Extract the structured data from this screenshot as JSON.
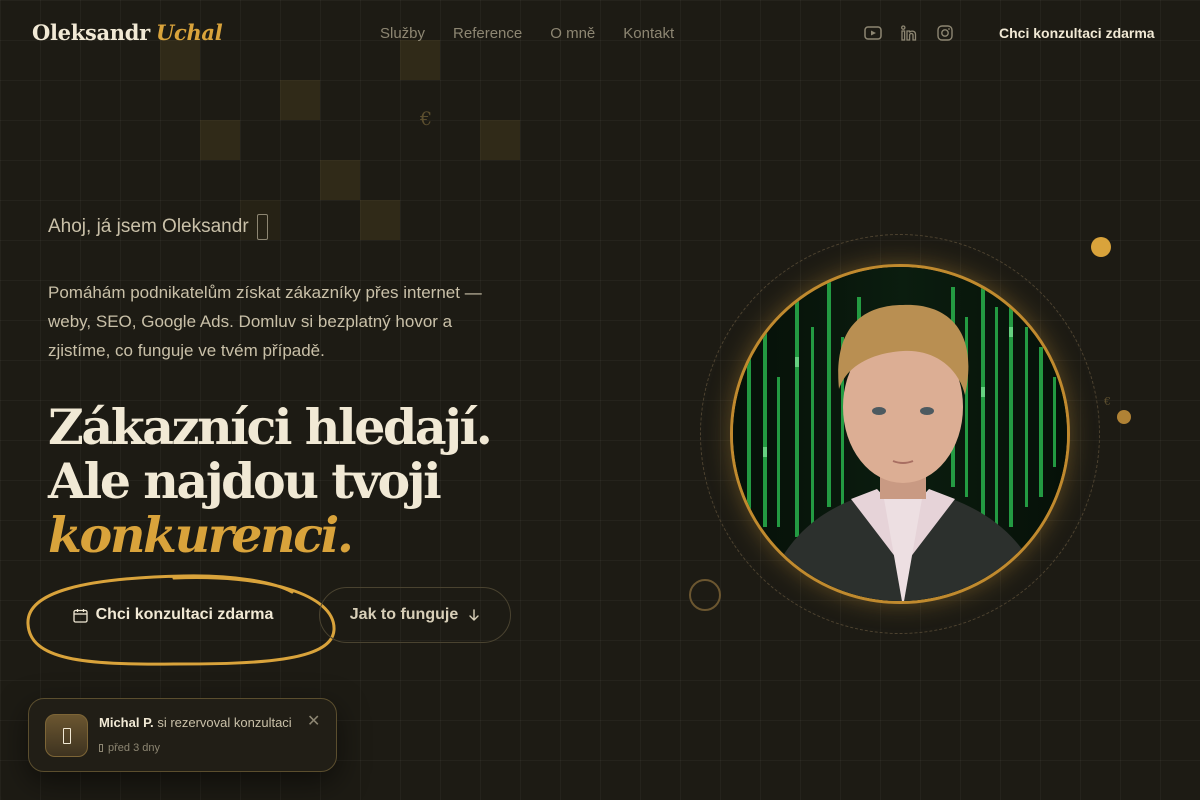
{
  "brand": {
    "first_name": "Oleksandr",
    "last_name": "Uchal",
    "accent_color": "#d9a33b"
  },
  "nav": {
    "items": [
      "Služby",
      "Reference",
      "O mně",
      "Kontakt"
    ]
  },
  "social": {
    "icons": [
      "youtube-icon",
      "linkedin-icon",
      "instagram-icon"
    ]
  },
  "header": {
    "cta_label": "Chci konzultaci zdarma"
  },
  "hero": {
    "greeting": "Ahoj, já jsem Oleksandr",
    "lead": "Pomáhám podnikatelům získat zákazníky přes internet — weby, SEO, Google Ads. Domluv si bezplatný hovor a zjistíme, co funguje ve tvém případě.",
    "headline_line1": "Zákazníci hledají.",
    "headline_line2": "Ale najdou tvoji",
    "headline_highlight": "konkurenci.",
    "primary_cta": "Chci konzultaci zdarma",
    "secondary_cta": "Jak to funguje"
  },
  "toast": {
    "name": "Michal P.",
    "action": "si rezervoval konzultaci",
    "time": "před 3 dny",
    "close_symbol": "✕"
  }
}
